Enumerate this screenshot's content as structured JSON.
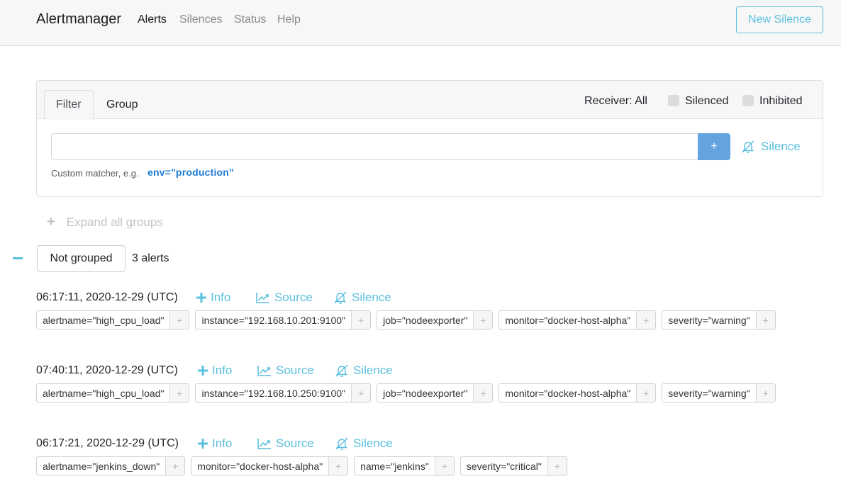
{
  "navbar": {
    "brand": "Alertmanager",
    "links": [
      {
        "label": "Alerts",
        "active": true
      },
      {
        "label": "Silences",
        "active": false
      },
      {
        "label": "Status",
        "active": false
      },
      {
        "label": "Help",
        "active": false
      }
    ],
    "new_silence_label": "New Silence"
  },
  "filter": {
    "tabs": [
      {
        "label": "Filter",
        "active": true
      },
      {
        "label": "Group",
        "active": false
      }
    ],
    "receiver_label": "Receiver: All",
    "silenced_label": "Silenced",
    "silenced_checked": false,
    "inhibited_label": "Inhibited",
    "inhibited_checked": false,
    "input_value": "",
    "input_placeholder": "",
    "add_button_label": "+",
    "silence_label": "Silence",
    "hint_text": "Custom matcher, e.g.",
    "hint_example": "env=\"production\""
  },
  "expand_all": {
    "icon": "+",
    "label": "Expand all groups"
  },
  "group": {
    "collapse_icon": "minus-icon",
    "name": "Not grouped",
    "count_label": "3 alerts"
  },
  "alert_actions": {
    "info": "Info",
    "source": "Source",
    "silence": "Silence"
  },
  "colors": {
    "accent": "#5bc0de",
    "primary_button": "#63a4e0",
    "link": "#1e7bd6"
  },
  "alerts": [
    {
      "time": "06:17:11, 2020-12-29 (UTC)",
      "labels": [
        "alertname=\"high_cpu_load\"",
        "instance=\"192.168.10.201:9100\"",
        "job=\"nodeexporter\"",
        "monitor=\"docker-host-alpha\"",
        "severity=\"warning\""
      ]
    },
    {
      "time": "07:40:11, 2020-12-29 (UTC)",
      "labels": [
        "alertname=\"high_cpu_load\"",
        "instance=\"192.168.10.250:9100\"",
        "job=\"nodeexporter\"",
        "monitor=\"docker-host-alpha\"",
        "severity=\"warning\""
      ]
    },
    {
      "time": "06:17:21, 2020-12-29 (UTC)",
      "labels": [
        "alertname=\"jenkins_down\"",
        "monitor=\"docker-host-alpha\"",
        "name=\"jenkins\"",
        "severity=\"critical\""
      ]
    }
  ]
}
